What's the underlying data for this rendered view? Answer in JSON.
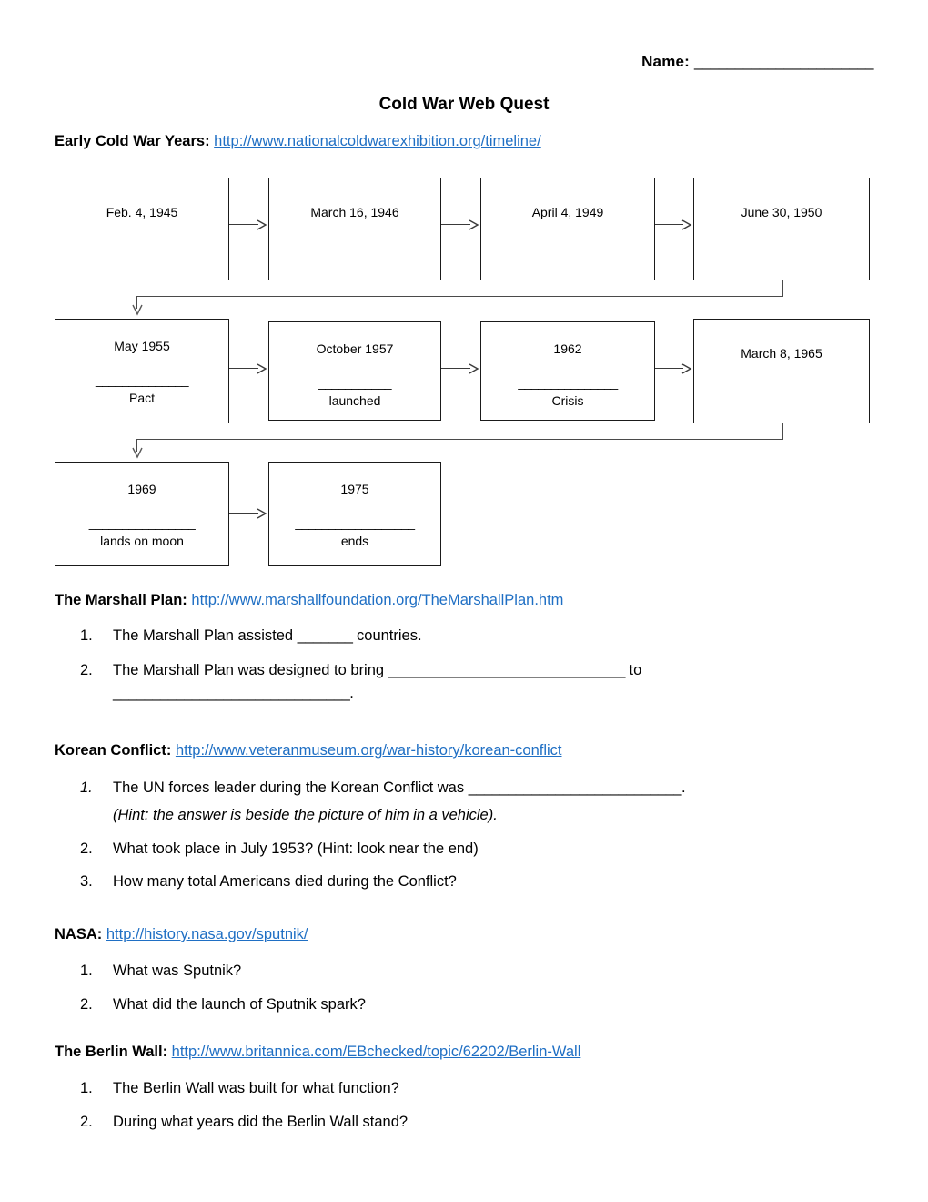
{
  "header": {
    "name_label": "Name:",
    "name_blank": "______________________",
    "title": "Cold War Web Quest"
  },
  "sections": [
    {
      "id": "early-cold-war-years",
      "heading": "Early Cold War Years:",
      "url": "http://www.nationalcoldwarexhibition.org/timeline/"
    },
    {
      "id": "marshall-plan",
      "heading": "The Marshall Plan:",
      "url": "http://www.marshallfoundation.org/TheMarshallPlan.htm",
      "questions": [
        {
          "num": "1.",
          "text_before": "The Marshall Plan assisted ",
          "blank": "_______",
          "text_after": " countries."
        },
        {
          "num": "2.",
          "text_before": "The Marshall Plan was designed to bring ",
          "blank": "______________________________",
          "text_after": " to"
        },
        {
          "num": "",
          "text_before": "",
          "blank": "______________________________",
          "text_after": "."
        }
      ]
    },
    {
      "id": "korean-conflict",
      "heading": "Korean Conflict:",
      "url": "http://www.veteranmuseum.org/war-history/korean-conflict",
      "questions": [
        {
          "num": "1.",
          "italic_num": true,
          "text_before": "The UN forces leader during the Korean Conflict was ",
          "blank": "___________________________",
          "text_after": "."
        },
        {
          "note": "(Hint: the answer is beside the picture of him in a vehicle)."
        },
        {
          "num": "2.",
          "text_before": "What took place in July 1953? (Hint: look near the end)",
          "blank": "",
          "text_after": ""
        },
        {
          "num": "3.",
          "text_before": "How many total Americans died during the Conflict?",
          "blank": "",
          "text_after": ""
        }
      ]
    },
    {
      "id": "nasa",
      "heading": "NASA:",
      "url": "http://history.nasa.gov/sputnik/",
      "questions": [
        {
          "num": "1.",
          "text_before": "What was Sputnik?",
          "blank": "",
          "text_after": ""
        },
        {
          "num": "2.",
          "text_before": "What did the launch of Sputnik spark?",
          "blank": "",
          "text_after": ""
        }
      ]
    },
    {
      "id": "berlin-wall",
      "heading": "The Berlin Wall:",
      "url": "http://www.britannica.com/EBchecked/topic/62202/Berlin-Wall",
      "questions": [
        {
          "num": "1.",
          "text_before": "The Berlin Wall was built for what function?",
          "blank": "",
          "text_after": ""
        },
        {
          "num": "2.",
          "text_before": "During what years did the Berlin Wall stand?",
          "blank": "",
          "text_after": ""
        }
      ]
    }
  ],
  "timeline": {
    "row1": [
      {
        "date": "Feb. 4, 1945",
        "blank": "",
        "label": ""
      },
      {
        "date": "March 16, 1946",
        "blank": "",
        "label": ""
      },
      {
        "date": "April 4, 1949",
        "blank": "",
        "label": ""
      },
      {
        "date": "June 30, 1950",
        "blank": "",
        "label": ""
      }
    ],
    "row2": [
      {
        "date": "May 1955",
        "blank": "______________",
        "label": "Pact"
      },
      {
        "date": "October 1957",
        "blank": "___________",
        "label": "launched"
      },
      {
        "date": "1962",
        "blank": "_______________",
        "label": "Crisis"
      },
      {
        "date": "March 8, 1965",
        "blank": "",
        "label": ""
      }
    ],
    "row3": [
      {
        "date": "1969",
        "blank": "________________",
        "label": "lands on moon"
      },
      {
        "date": "1975",
        "blank": "__________________",
        "label": "ends"
      }
    ]
  },
  "colors": {
    "link": "#1f6fc4",
    "box_border": "#1a1a1a",
    "arrow": "#3a3a3a"
  }
}
